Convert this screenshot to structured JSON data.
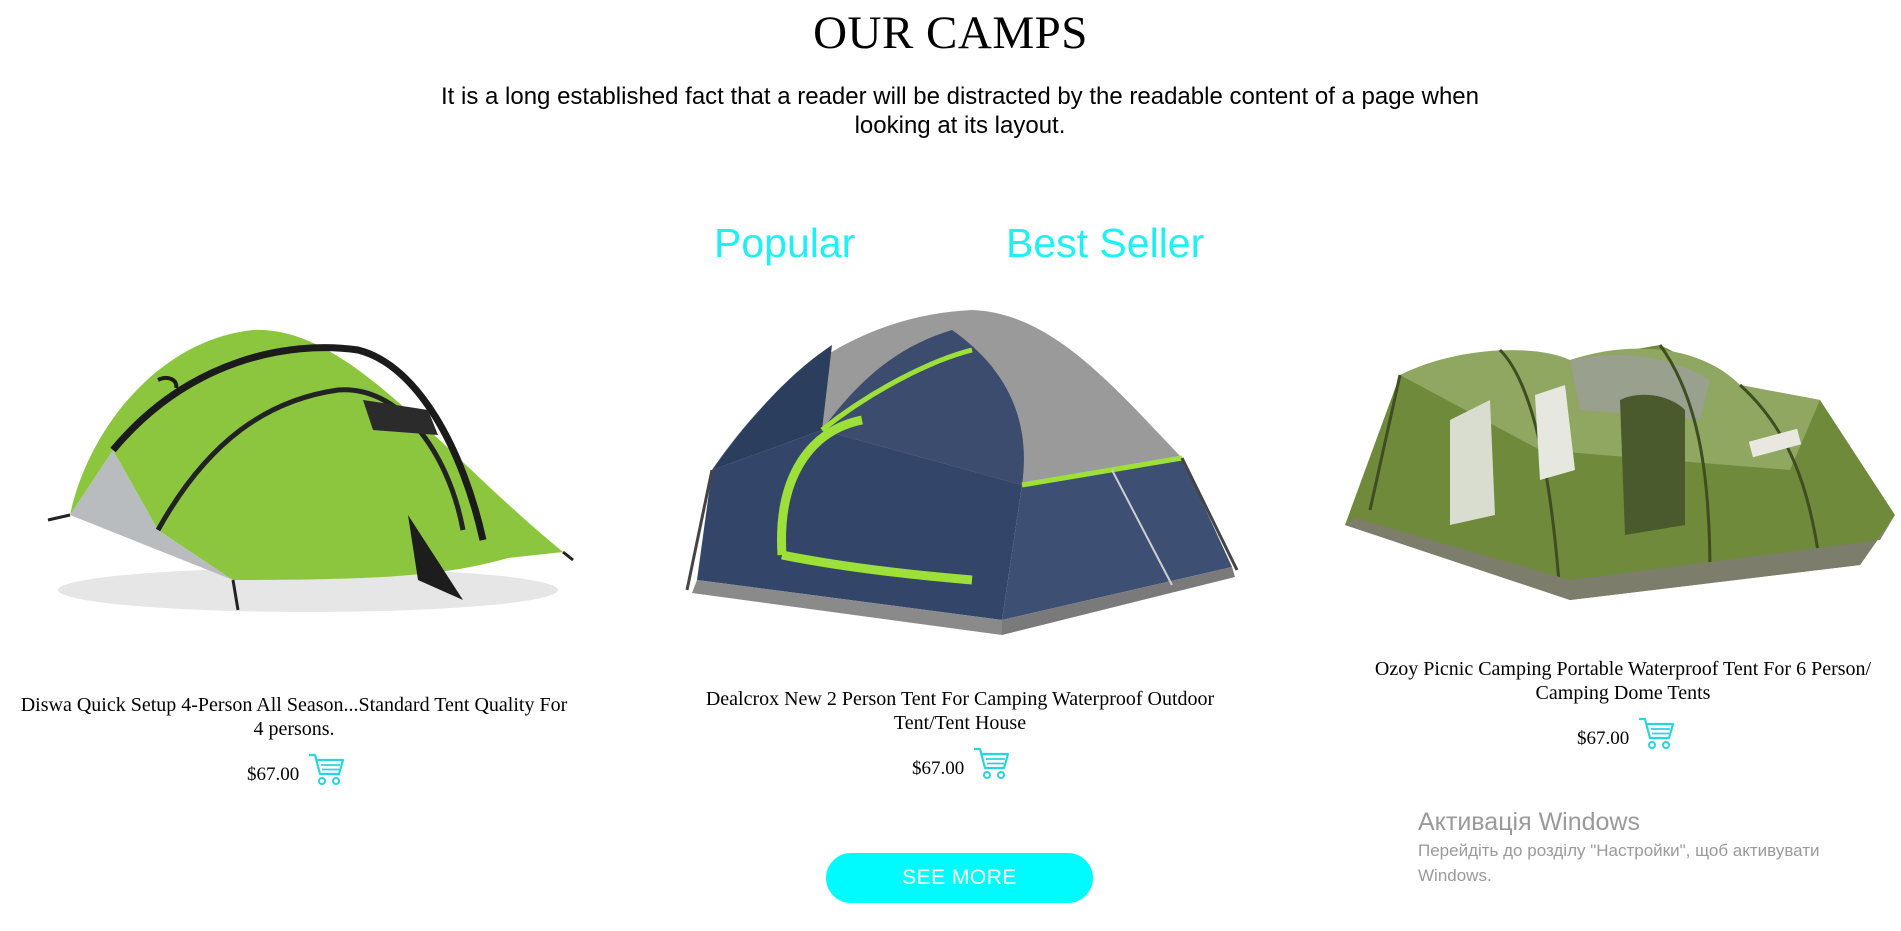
{
  "section": {
    "title": "OUR CAMPS",
    "intro": "It is a long established fact that a reader will be distracted by the readable content of a page when looking at its layout."
  },
  "tags": {
    "popular": "Popular",
    "best_seller": "Best Seller"
  },
  "accent_color": "#00fbff",
  "products": [
    {
      "title": "Diswa Quick Setup 4-Person All Season...Standard Tent Quality For 4 persons.",
      "price": "$67.00",
      "image": "green-dome-tent",
      "cart_icon": "shopping-cart-icon"
    },
    {
      "title": "Dealcrox New 2 Person Tent For Camping Waterproof Outdoor Tent/Tent House",
      "price": "$67.00",
      "image": "navy-grey-dome-tent",
      "cart_icon": "shopping-cart-icon"
    },
    {
      "title": "Ozoy Picnic Camping Portable Waterproof Tent For 6 Person/ Camping Dome Tents",
      "price": "$67.00",
      "image": "olive-tunnel-tent",
      "cart_icon": "shopping-cart-icon"
    }
  ],
  "see_more_label": "SEE MORE",
  "watermark": {
    "title": "Активація Windows",
    "text": "Перейдіть до розділу \"Настройки\", щоб активувати Windows."
  }
}
